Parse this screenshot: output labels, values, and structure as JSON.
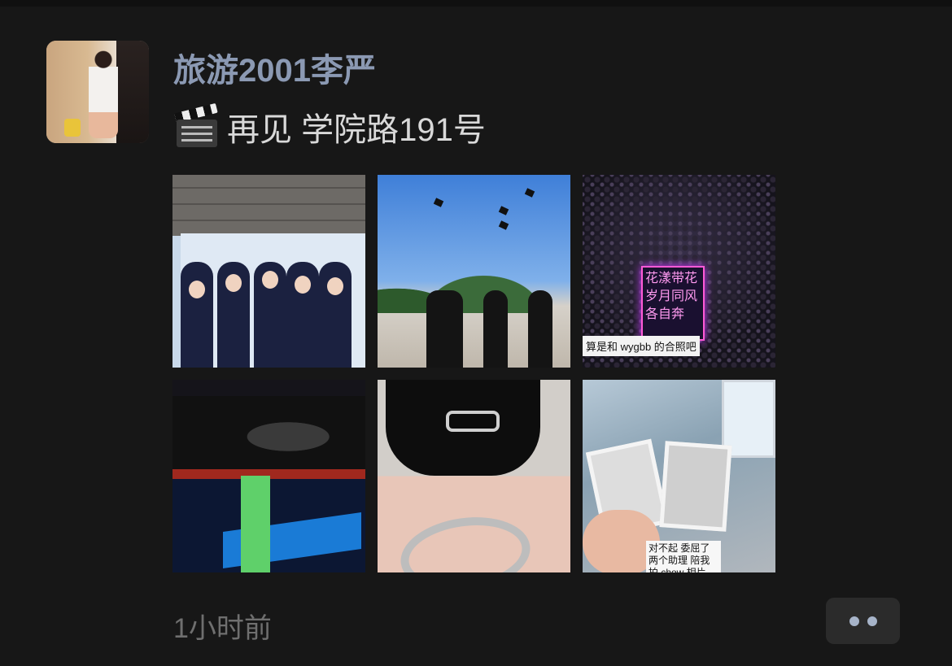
{
  "post": {
    "username": "旅游2001李严",
    "text_emoji": "clapper-board-icon",
    "text": "再见 学院路191号",
    "timestamp": "1小时前"
  },
  "photos": [
    {
      "name": "graduation-group-photo",
      "caption": ""
    },
    {
      "name": "caps-thrown-photo",
      "caption": ""
    },
    {
      "name": "night-crowd-photo",
      "caption": "算是和 wygbb 的合照吧",
      "sign_text": "花漾带花 岁月同风 各自奔"
    },
    {
      "name": "stage-performance-photo",
      "caption": ""
    },
    {
      "name": "ring-photo",
      "caption": ""
    },
    {
      "name": "polaroid-photo",
      "caption": "对不起 委屈了两个助理 陪我拍 chow 相片"
    }
  ],
  "colors": {
    "background": "#171717",
    "username": "#8b99b3",
    "text": "#d9d9d9",
    "timestamp": "#6f6f6f",
    "more_button_bg": "#2b2b2b",
    "more_button_dots": "#a7b4c9"
  },
  "more_button_icon": "ellipsis-icon"
}
